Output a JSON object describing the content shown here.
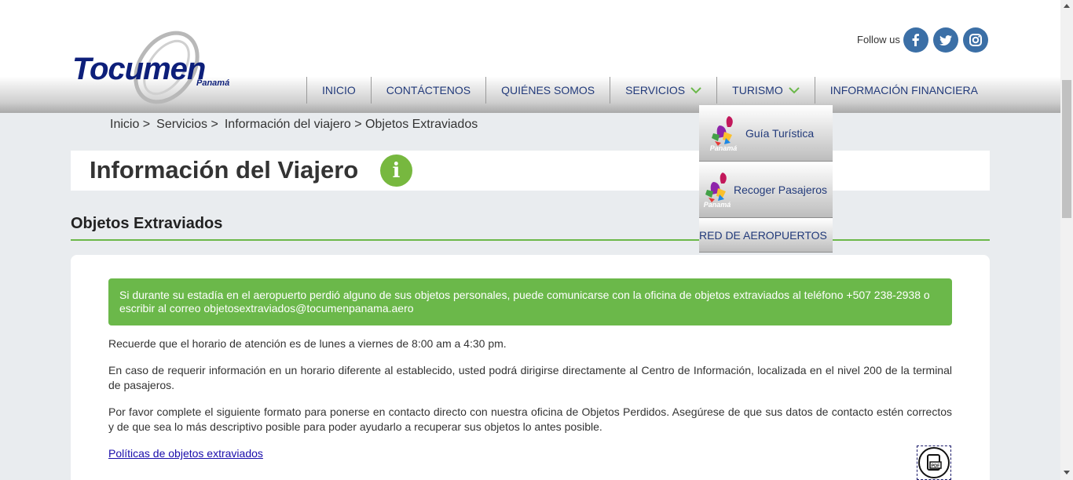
{
  "header": {
    "logo_text": "Tocumen",
    "logo_sub": "Panamá",
    "follow_label": "Follow us",
    "social": [
      {
        "name": "facebook-icon",
        "color": "#3b6fa6"
      },
      {
        "name": "twitter-icon",
        "color": "#3b6fa6"
      },
      {
        "name": "instagram-icon",
        "color": "#3b6fa6"
      }
    ]
  },
  "nav": {
    "items": [
      {
        "label": "INICIO",
        "dropdown": false
      },
      {
        "label": "CONTÁCTENOS",
        "dropdown": false
      },
      {
        "label": "QUIÉNES SOMOS",
        "dropdown": false
      },
      {
        "label": "SERVICIOS",
        "dropdown": true
      },
      {
        "label": "TURISMO",
        "dropdown": true
      },
      {
        "label": "INFORMACIÓN FINANCIERA",
        "dropdown": false
      }
    ]
  },
  "dropdown": {
    "items": [
      {
        "label": "Guía Turística",
        "logo_text": "Panamá"
      },
      {
        "label": "Recoger Pasajeros",
        "logo_text": "Panamá"
      },
      {
        "label": "RED DE AEROPUERTOS"
      }
    ]
  },
  "breadcrumb": {
    "items": [
      "Inicio >",
      "Servicios >",
      "Información del viajero > Objetos Extraviados"
    ]
  },
  "page": {
    "title": "Información del Viajero",
    "info_icon": "i",
    "section_title": "Objetos Extraviados",
    "alert": "Si durante su estadía en el aeropuerto perdió alguno de sus objetos personales, puede comunicarse con la oficina de objetos extraviados al teléfono +507 238-2938 o escribir al correo objetosextraviados@tocumenpanama.aero",
    "paragraphs": [
      "Recuerde que el horario de atención es de lunes a viernes de 8:00 am a 4:30 pm.",
      "En caso de requerir información en un horario diferente al establecido, usted podrá dirigirse directamente al Centro de Información, localizada en el nivel 200 de la terminal de pasajeros.",
      "Por favor complete el siguiente formato para ponerse en contacto directo con nuestra oficina de Objetos Perdidos. Asegúrese de que sus datos de contacto estén correctos y de que sea lo más descriptivo posible para poder ayudarlo a recuperar sus objetos lo antes posible."
    ],
    "link": "Políticas de objetos extraviados",
    "pdf_label": "PDF"
  },
  "colors": {
    "brand_navy": "#0d1f7a",
    "accent_green": "#6bb84a",
    "nav_text": "#223a7a",
    "social_blue": "#3b6fa6"
  }
}
